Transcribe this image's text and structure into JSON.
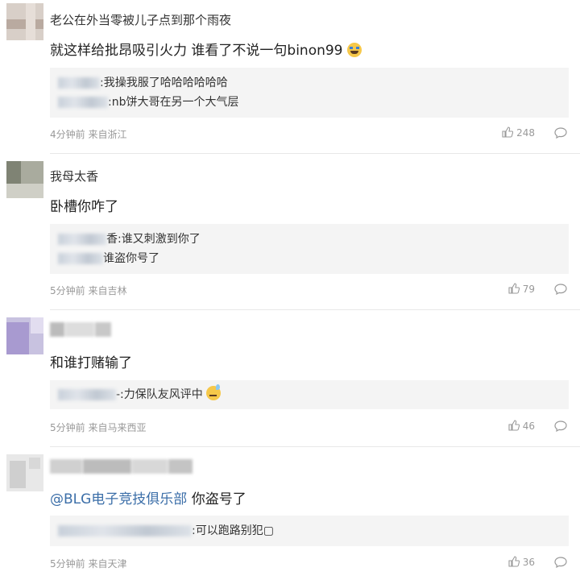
{
  "comments": [
    {
      "name": "老公在外当零被儿子点到那个雨夜",
      "text": "就这样给批昂吸引火力 谁看了不说一句binon99",
      "emoji": "crying-face",
      "replies": [
        {
          "text": ":我操我服了哈哈哈哈哈哈"
        },
        {
          "text": ":nb饼大哥在另一个大气层"
        }
      ],
      "meta": "4分钟前 来自浙江",
      "likes": "248"
    },
    {
      "name": "我母太香",
      "text": "卧槽你咋了",
      "replies": [
        {
          "text": "香:谁又刺激到你了"
        },
        {
          "text": "谁盗你号了"
        }
      ],
      "meta": "5分钟前 来自吉林",
      "likes": "79"
    },
    {
      "name": "",
      "text": "和谁打赌输了",
      "replies": [
        {
          "text": "-:力保队友风评中",
          "emoji": "sweat-smile"
        }
      ],
      "meta": "5分钟前 来自马来西亚",
      "likes": "46"
    },
    {
      "name": "",
      "mention": "@BLG电子竞技俱乐部",
      "text": " 你盗号了",
      "replies": [
        {
          "text": ":可以跑路别犯▢"
        }
      ],
      "meta": "5分钟前 来自天津",
      "likes": "36"
    }
  ]
}
